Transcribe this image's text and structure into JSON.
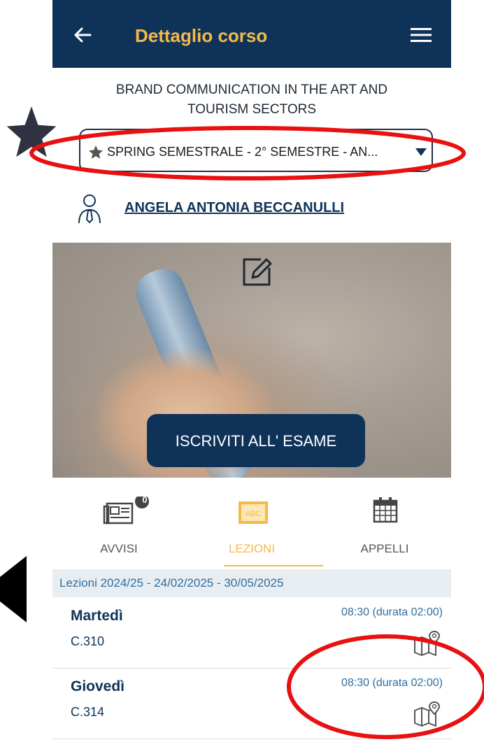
{
  "header": {
    "title": "Dettaglio corso",
    "back_icon": "arrow-left-icon",
    "menu_icon": "hamburger-menu-icon",
    "background": "#0f3358",
    "title_color": "#f5b94a"
  },
  "course": {
    "name_line1": "BRAND COMMUNICATION IN THE ART AND",
    "name_line2": "TOURISM SECTORS"
  },
  "session_select": {
    "value": "SPRING SEMESTRALE - 2° SEMESTRE - AN...",
    "icon": "star-icon"
  },
  "teacher": {
    "name": "ANGELA ANTONIA BECCANULLI",
    "icon": "person-tie-icon"
  },
  "hero": {
    "button_label": "ISCRIVITI ALL' ESAME",
    "edit_icon": "edit-icon"
  },
  "tabs": [
    {
      "label": "AVVISI",
      "icon": "newspaper-icon",
      "badge": "0"
    },
    {
      "label": "LEZIONI",
      "icon": "abc-board-icon",
      "active": true
    },
    {
      "label": "APPELLI",
      "icon": "calendar-icon"
    }
  ],
  "lessons": {
    "period": "Lezioni 2024/25 - 24/02/2025 - 30/05/2025",
    "rows": [
      {
        "day": "Martedì",
        "room": "C.310",
        "time": "08:30 (durata 02:00)",
        "icon": "map-pin-icon"
      },
      {
        "day": "Giovedì",
        "room": "C.314",
        "time": "08:30 (durata 02:00)",
        "icon": "map-pin-icon"
      }
    ]
  },
  "accent_colors": {
    "navy": "#0f3358",
    "gold": "#f5b94a",
    "annotation_red": "#e81010"
  }
}
